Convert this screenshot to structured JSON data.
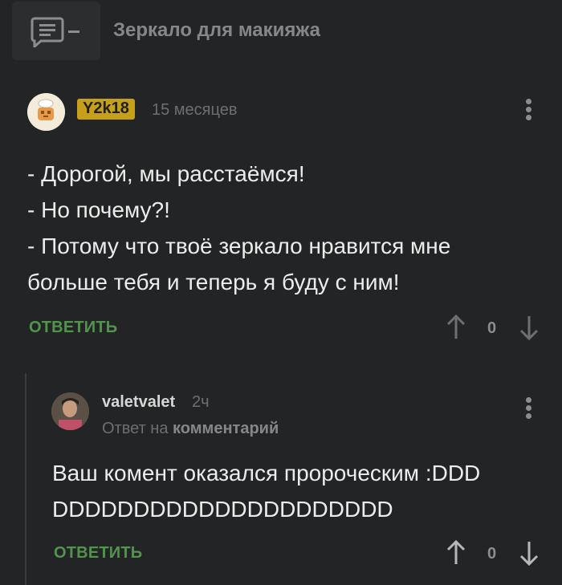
{
  "post": {
    "title": "Зеркало для макияжа",
    "icon": "comment-icon"
  },
  "comments": [
    {
      "author": "Y2k18",
      "author_badge_color": "#c7a01b",
      "time": "15 месяцев",
      "text": "- Дорогой, мы расстаёмся!\n - Но почему?!\n - Потому что твоё зеркало нравится мне\nбольше тебя и теперь я буду с ним!",
      "reply_label": "ОТВЕТИТЬ",
      "votes": "0"
    },
    {
      "author": "valetvalet",
      "time": "2ч",
      "reply_to_prefix": "Ответ на",
      "reply_to_target": "комментарий",
      "text": "Ваш комент оказался пророческим :DDD\nDDDDDDDDDDDDDDDDDDDDD",
      "reply_label": "ОТВЕТИТЬ",
      "votes": "0"
    }
  ],
  "colors": {
    "background": "#232425",
    "reply_green": "#52944d",
    "muted": "#6c6f73"
  }
}
